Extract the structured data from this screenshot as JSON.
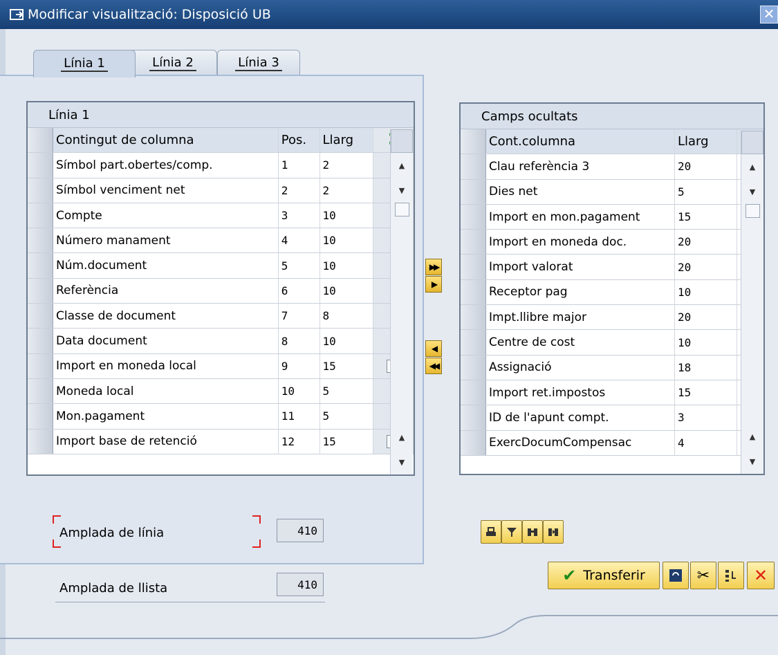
{
  "window": {
    "title": "Modificar visualització: Disposició UB",
    "close": "✕"
  },
  "tabs": [
    "Línia 1",
    "Línia 2",
    "Línia 3"
  ],
  "left_grid": {
    "title": "Línia 1",
    "headers": {
      "content": "Contingut de columna",
      "pos": "Pos.",
      "len": "Llarg",
      "sum": "Σ"
    },
    "rows": [
      {
        "content": "Símbol part.obertes/comp.",
        "pos": "1",
        "len": "2",
        "sum": ""
      },
      {
        "content": "Símbol venciment net",
        "pos": "2",
        "len": "2",
        "sum": ""
      },
      {
        "content": "Compte",
        "pos": "3",
        "len": "10",
        "sum": ""
      },
      {
        "content": "Número manament",
        "pos": "4",
        "len": "10",
        "sum": ""
      },
      {
        "content": "Núm.document",
        "pos": "5",
        "len": "10",
        "sum": ""
      },
      {
        "content": "Referència",
        "pos": "6",
        "len": "10",
        "sum": ""
      },
      {
        "content": "Classe de document",
        "pos": "7",
        "len": "8",
        "sum": ""
      },
      {
        "content": "Data document",
        "pos": "8",
        "len": "10",
        "sum": ""
      },
      {
        "content": "Import en moneda local",
        "pos": "9",
        "len": "15",
        "sum": "checked"
      },
      {
        "content": "Moneda local",
        "pos": "10",
        "len": "5",
        "sum": ""
      },
      {
        "content": "Mon.pagament",
        "pos": "11",
        "len": "5",
        "sum": ""
      },
      {
        "content": "Import base de retenció",
        "pos": "12",
        "len": "15",
        "sum": "unchecked"
      }
    ]
  },
  "right_grid": {
    "title": "Camps ocultats",
    "headers": {
      "content": "Cont.columna",
      "len": "Llarg"
    },
    "rows": [
      {
        "content": "Clau referència 3",
        "len": "20"
      },
      {
        "content": "Dies net",
        "len": "5"
      },
      {
        "content": "Import en mon.pagament",
        "len": "15"
      },
      {
        "content": "Import en moneda doc.",
        "len": "20"
      },
      {
        "content": "Import valorat",
        "len": "20"
      },
      {
        "content": "Receptor pag",
        "len": "10"
      },
      {
        "content": "Impt.llibre major",
        "len": "20"
      },
      {
        "content": "Centre de cost",
        "len": "10"
      },
      {
        "content": "Assignació",
        "len": "18"
      },
      {
        "content": "Import ret.impostos",
        "len": "15"
      },
      {
        "content": "ID de l'apunt compt.",
        "len": "3"
      },
      {
        "content": "ExercDocumCompensac",
        "len": "4"
      }
    ]
  },
  "fields": {
    "line_width": {
      "label": "Amplada de línia",
      "value": "410"
    },
    "list_width": {
      "label": "Amplada de llista",
      "value": "410"
    }
  },
  "buttons": {
    "transfer": "Transferir"
  },
  "colors": {
    "titlebar": "#1f4d86",
    "button_yellow": "#f2cf52",
    "panel": "#dfe6f0"
  }
}
